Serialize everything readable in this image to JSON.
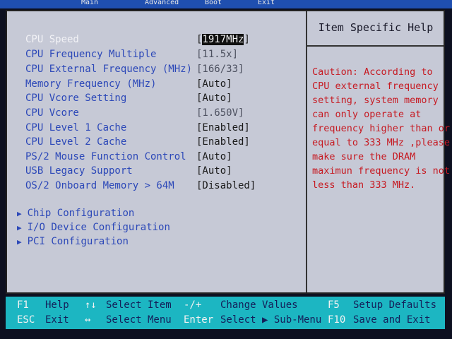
{
  "top_tabs": [
    "Main",
    "Advanced",
    "Boot",
    "Exit"
  ],
  "help": {
    "title": "Item Specific Help",
    "lines": [
      "Caution: According to",
      "CPU external frequency",
      "setting, system memory",
      "can only operate at",
      "frequency higher than or",
      "equal to 333 MHz ,please",
      "make sure the DRAM",
      "maximun frequency is not",
      "less than 333 MHz."
    ]
  },
  "settings": [
    {
      "label": "CPU Speed",
      "value": "1917MHz"
    },
    {
      "label": "CPU Frequency Multiple",
      "value": "[11.5x]"
    },
    {
      "label": "CPU External Frequency (MHz)",
      "value": "[166/33]"
    },
    {
      "label": "Memory Frequency (MHz)",
      "value": "[Auto]"
    },
    {
      "label": "CPU Vcore Setting",
      "value": "[Auto]"
    },
    {
      "label": "CPU Vcore",
      "value": "[1.650V]"
    },
    {
      "label": "CPU Level 1 Cache",
      "value": "[Enabled]"
    },
    {
      "label": "CPU Level 2 Cache",
      "value": "[Enabled]"
    },
    {
      "label": "PS/2 Mouse Function Control",
      "value": "[Auto]"
    },
    {
      "label": "USB Legacy Support",
      "value": "[Auto]"
    },
    {
      "label": "OS/2 Onboard Memory > 64M",
      "value": "[Disabled]"
    }
  ],
  "submenus": [
    {
      "label": "Chip Configuration"
    },
    {
      "label": "I/O Device Configuration"
    },
    {
      "label": "PCI Configuration"
    }
  ],
  "bracket_open": "[",
  "bracket_close": "]",
  "keybar": {
    "f1_key": "F1",
    "f1_desc": "Help",
    "updown_key": "↑↓",
    "updown_desc": "Select Item",
    "minus_plus_key": "-/+",
    "minus_plus_desc": "Change Values",
    "f5_key": "F5",
    "f5_desc": "Setup Defaults",
    "esc_key": "ESC",
    "esc_desc": "Exit",
    "leftright_key": "↔",
    "leftright_desc": "Select Menu",
    "enter_key": "Enter",
    "enter_desc": "Select ▶ Sub-Menu",
    "f10_key": "F10",
    "f10_desc": "Save and Exit"
  }
}
